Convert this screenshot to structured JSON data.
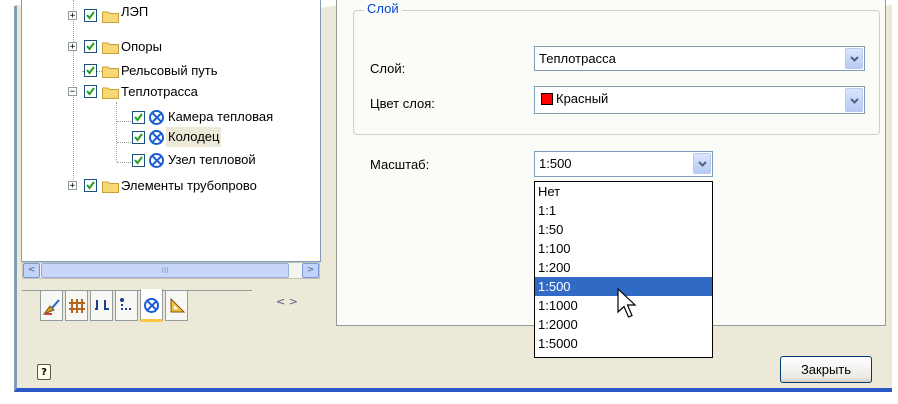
{
  "tree": {
    "items": [
      {
        "label": "ЛЭП",
        "expander": "+"
      },
      {
        "label": "Опоры",
        "expander": "+"
      },
      {
        "label": "Рельсовый путь",
        "expander": ""
      },
      {
        "label": "Теплотрасса",
        "expander": "−"
      },
      {
        "label": "Камера тепловая"
      },
      {
        "label": "Колодец"
      },
      {
        "label": "Узел тепловой"
      },
      {
        "label": "Элементы трубопрово",
        "expander": "+"
      }
    ],
    "scroll_thumb_grip": "III",
    "scroll_left": "<",
    "scroll_right": ">"
  },
  "tabs": {
    "icons": [
      "broom-icon",
      "fence-icon",
      "rail-icon",
      "dotted-path-icon",
      "cross-circle-icon",
      "triangle-ruler-icon"
    ],
    "nav": "< >"
  },
  "layer_group": {
    "title": "Слой",
    "layer_label": "Слой:",
    "layer_value": "Теплотрасса",
    "color_label": "Цвет слоя:",
    "color_value": "Красный",
    "color_swatch": "#ff0000"
  },
  "scale": {
    "label": "Масштаб:",
    "value": "1:500",
    "options": [
      "Нет",
      "1:1",
      "1:50",
      "1:100",
      "1:200",
      "1:500",
      "1:1000",
      "1:2000",
      "1:5000"
    ],
    "selected_index": 5
  },
  "footer": {
    "help": "?",
    "close_button": "Закрыть"
  },
  "colors": {
    "selection": "#316ac5",
    "group_title": "#0046d5",
    "window_border": "#2a58c6"
  }
}
